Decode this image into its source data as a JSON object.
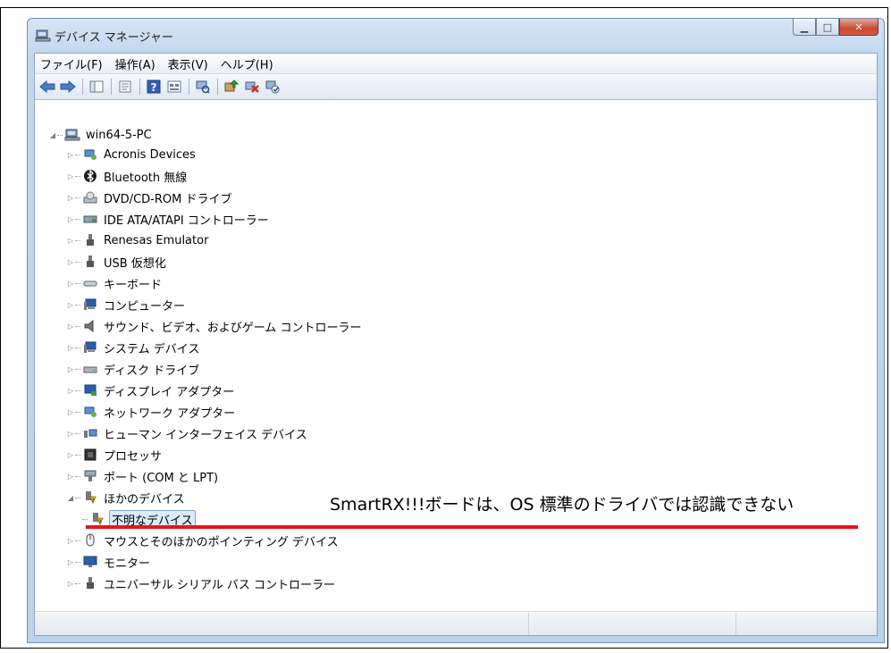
{
  "window": {
    "title": "デバイス マネージャー"
  },
  "menu": [
    "ファイル(F)",
    "操作(A)",
    "表示(V)",
    "ヘルプ(H)"
  ],
  "tree": {
    "root": "win64-5-PC",
    "items": [
      "Acronis Devices",
      "Bluetooth 無線",
      "DVD/CD-ROM ドライブ",
      "IDE ATA/ATAPI コントローラー",
      "Renesas Emulator",
      "USB 仮想化",
      "キーボード",
      "コンピューター",
      "サウンド、ビデオ、およびゲーム コントローラー",
      "システム デバイス",
      "ディスク ドライブ",
      "ディスプレイ アダプター",
      "ネットワーク アダプター",
      "ヒューマン インターフェイス デバイス",
      "プロセッサ",
      "ポート (COM と LPT)",
      "ほかのデバイス",
      "不明なデバイス",
      "マウスとそのほかのポインティング デバイス",
      "モニター",
      "ユニバーサル シリアル バス コントローラー"
    ]
  },
  "annotation": "SmartRX!!!ボードは、OS 標準のドライバでは認識できない",
  "colors": {
    "annotation_line": "#e8141c",
    "selection": "#dcebfc"
  }
}
